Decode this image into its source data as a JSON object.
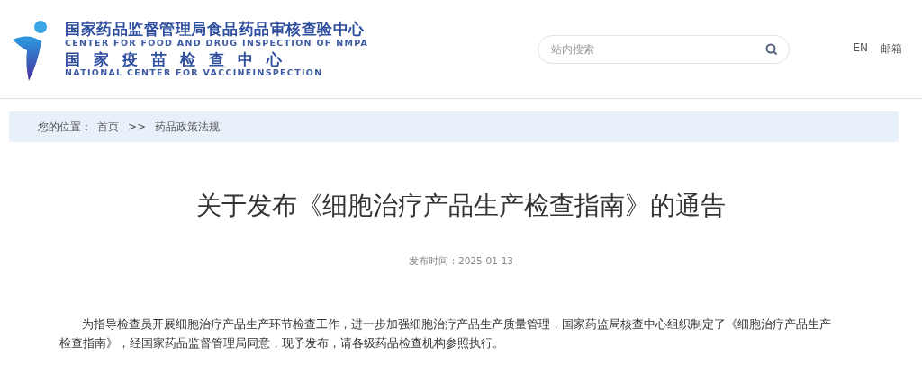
{
  "header": {
    "logo": {
      "title_cn": "国家药品监督管理局食品药品审核查验中心",
      "title_en": "CENTER FOR FOOD AND DRUG INSPECTION OF NMPA",
      "subtitle_cn": "国家疫苗检查中心",
      "subtitle_en": "NATIONAL CENTER FOR VACCINEINSPECTION"
    },
    "search": {
      "placeholder": "站内搜索"
    },
    "links": [
      "EN",
      "邮箱"
    ]
  },
  "breadcrumb": {
    "label": "您的位置：",
    "items": [
      {
        "text": "首页",
        "kind": "link"
      },
      {
        "text": ">>",
        "kind": "separator"
      },
      {
        "text": "药品政策法规",
        "kind": "link"
      }
    ]
  },
  "article": {
    "title": "关于发布《细胞治疗产品生产检查指南》的通告",
    "date": "发布时间：2025-01-13",
    "paragraphs": [
      "为指导检查员开展细胞治疗产品生产环节检查工作，进一步加强细胞治疗产品生产质量管理，国家药监局核查中心组织制定了《细胞治疗产品生产检查指南》，经国家药品监督管理局同意，现予发布，请各级药品检查机构参照执行。"
    ]
  }
}
